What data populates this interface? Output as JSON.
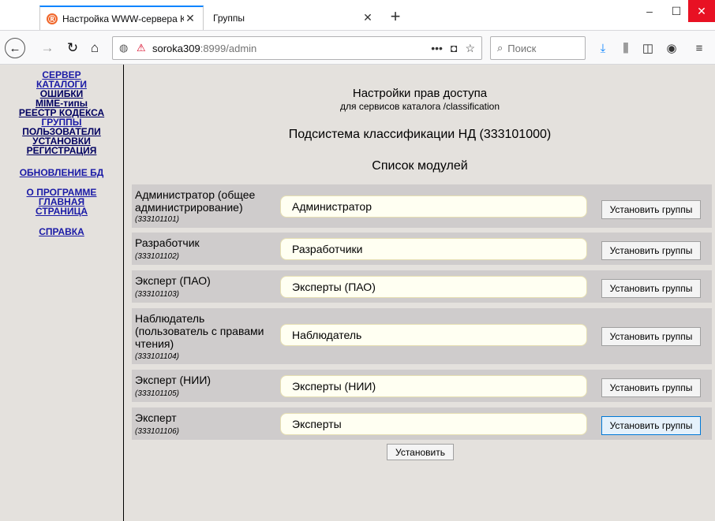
{
  "browser": {
    "tabs": [
      {
        "label": "Настройка WWW-сервера КО",
        "favicon": "Ⓡ",
        "close": "✕"
      },
      {
        "label": "Группы",
        "close": "✕"
      }
    ],
    "new_tab": "+",
    "window": {
      "minimize": "–",
      "maximize": "☐",
      "close": "✕"
    },
    "url_host": "soroka309",
    "url_path": ":8999/admin",
    "search_placeholder": "Поиск"
  },
  "sidebar": {
    "links": [
      "СЕРВЕР",
      "КАТАЛОГИ",
      "ОШИБКИ",
      "MIME-типы",
      "РЕЕСТР КОДЕКСА",
      "ГРУППЫ",
      "ПОЛЬЗОВАТЕЛИ",
      "УСТАНОВКИ",
      "РЕГИСТРАЦИЯ",
      "ОБНОВЛЕНИЕ БД",
      "О ПРОГРАММЕ",
      "ГЛАВНАЯ",
      "СТРАНИЦА",
      "СПРАВКА"
    ]
  },
  "main": {
    "title": "Настройки прав доступа",
    "subtitle": "для сервисов каталога /classification",
    "subsystem": "Подсистема классификации НД (333101000)",
    "list_title": "Список модулей",
    "set_groups_label": "Установить группы",
    "apply_label": "Установить",
    "modules": [
      {
        "name_lines": [
          "Администратор (общее",
          "администрирование)"
        ],
        "code": "(333101101)",
        "group": "Администратор"
      },
      {
        "name_lines": [
          "Разработчик"
        ],
        "code": "(333101102)",
        "group": "Разработчики"
      },
      {
        "name_lines": [
          "Эксперт (ПАО)"
        ],
        "code": "(333101103)",
        "group": "Эксперты (ПАО)"
      },
      {
        "name_lines": [
          "Наблюдатель",
          "(пользователь с правами",
          "чтения)"
        ],
        "code": "(333101104)",
        "group": "Наблюдатель"
      },
      {
        "name_lines": [
          "Эксперт (НИИ)"
        ],
        "code": "(333101105)",
        "group": "Эксперты (НИИ)"
      },
      {
        "name_lines": [
          "Эксперт"
        ],
        "code": "(333101106)",
        "group": "Эксперты"
      }
    ]
  }
}
